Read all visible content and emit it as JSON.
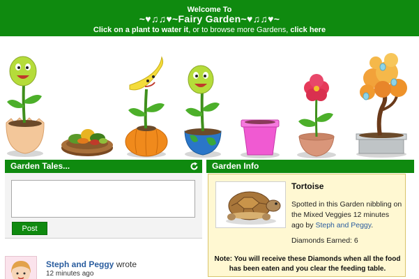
{
  "banner": {
    "welcome": "Welcome To",
    "garden_name": "~♥♫♫♥~Fairy Garden~♥♫♫♥~",
    "instruction_bold": "Click on a plant to water it",
    "instruction_mid": ", or to browse more Gardens, ",
    "instruction_link": "click here"
  },
  "plants": [
    {
      "name": "smiling-pea-pod-flower-in-eggshell"
    },
    {
      "name": "mixed-veggies-feeding-table"
    },
    {
      "name": "banana-flower-in-pumpkin"
    },
    {
      "name": "smiling-pea-pod-flower-in-globe-pot"
    },
    {
      "name": "pink-pot-empty"
    },
    {
      "name": "red-hibiscus-in-clay-pot"
    },
    {
      "name": "orange-bonsai-tree"
    }
  ],
  "tales": {
    "header": "Garden Tales...",
    "input_value": "",
    "post_label": "Post",
    "posts": [
      {
        "author": "Steph and Peggy",
        "action": " wrote",
        "time": "12 minutes ago"
      }
    ]
  },
  "info": {
    "header": "Garden Info",
    "title": "Tortoise",
    "desc_prefix": "Spotted in this Garden nibbling on the Mixed Veggies 12 minutes ago by ",
    "desc_who": "Steph and Peggy",
    "desc_suffix": ".",
    "diamonds": "Diamonds Earned: 6",
    "note": "Note: You will receive these Diamonds when all the food has been eaten and you clear the feeding table."
  },
  "colors": {
    "brand_green": "#0f8a0f",
    "link_blue": "#2a5d9f",
    "info_bg": "#fff8d2"
  }
}
